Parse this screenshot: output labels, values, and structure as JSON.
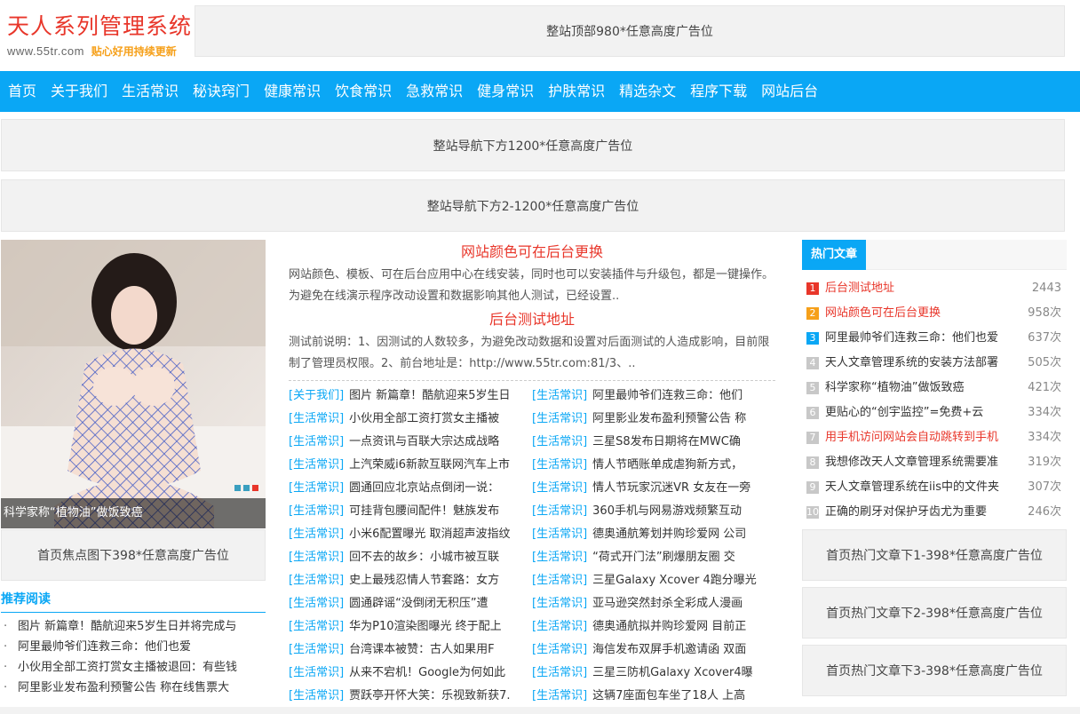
{
  "logo": {
    "title": "天人系列管理系统",
    "url": "www.55tr.com",
    "slogan": "贴心好用持续更新"
  },
  "ads": {
    "top": "整站顶部980*任意高度广告位",
    "nav1": "整站导航下方1200*任意高度广告位",
    "nav2": "整站导航下方2-1200*任意高度广告位",
    "focus_below": "首页焦点图下398*任意高度广告位",
    "hot1": "首页热门文章下1-398*任意高度广告位",
    "hot2": "首页热门文章下2-398*任意高度广告位",
    "hot3": "首页热门文章下3-398*任意高度广告位"
  },
  "nav": [
    "首页",
    "关于我们",
    "生活常识",
    "秘诀窍门",
    "健康常识",
    "饮食常识",
    "急救常识",
    "健身常识",
    "护肤常识",
    "精选杂文",
    "程序下载",
    "网站后台"
  ],
  "focus": {
    "caption": "科学家称“植物油”做饭致癌",
    "dot_colors": [
      "#3a9fbf",
      "#3a9fbf",
      "#e8362a"
    ]
  },
  "recommend": {
    "title": "推荐阅读",
    "items": [
      "图片 新篇章！酷航迎来5岁生日并将完成与",
      "阿里最帅爷们连救三命：他们也爱",
      "小伙用全部工资打赏女主播被退回：有些钱",
      "阿里影业发布盈利预警公告 称在线售票大"
    ]
  },
  "headlines": [
    {
      "title": "网站颜色可在后台更换",
      "summary": "网站颜色、模板、可在后台应用中心在线安装，同时也可以安装插件与升级包，都是一键操作。为避免在线演示程序改动设置和数据影响其他人测试，已经设置.."
    },
    {
      "title": "后台测试地址",
      "summary": "测试前说明：1、因测试的人数较多，为避免改动数据和设置对后面测试的人造成影响，目前限制了管理员权限。2、前台地址是：http://www.55tr.com:81/3、.."
    }
  ],
  "articles_left": [
    {
      "cat": "[关于我们]",
      "title": "图片 新篇章！酷航迎来5岁生日"
    },
    {
      "cat": "[生活常识]",
      "title": "小伙用全部工资打赏女主播被"
    },
    {
      "cat": "[生活常识]",
      "title": "一点资讯与百联大宗达成战略"
    },
    {
      "cat": "[生活常识]",
      "title": "上汽荣威i6新款互联网汽车上市"
    },
    {
      "cat": "[生活常识]",
      "title": "圆通回应北京站点倒闭一说："
    },
    {
      "cat": "[生活常识]",
      "title": "可挂背包腰间配件！魅族发布"
    },
    {
      "cat": "[生活常识]",
      "title": "小米6配置曝光 取消超声波指纹"
    },
    {
      "cat": "[生活常识]",
      "title": "回不去的故乡：小城市被互联"
    },
    {
      "cat": "[生活常识]",
      "title": "史上最残忍情人节套路：女方"
    },
    {
      "cat": "[生活常识]",
      "title": "圆通辟谣“没倒闭无积压”遭"
    },
    {
      "cat": "[生活常识]",
      "title": "华为P10渲染图曝光 终于配上"
    },
    {
      "cat": "[生活常识]",
      "title": "台湾课本被赞：古人如果用F"
    },
    {
      "cat": "[生活常识]",
      "title": "从来不宕机！Google为何如此"
    },
    {
      "cat": "[生活常识]",
      "title": "贾跃亭开怀大笑：乐视致新获7."
    }
  ],
  "articles_right": [
    {
      "cat": "[生活常识]",
      "title": "阿里最帅爷们连救三命：他们"
    },
    {
      "cat": "[生活常识]",
      "title": "阿里影业发布盈利预警公告 称"
    },
    {
      "cat": "[生活常识]",
      "title": "三星S8发布日期将在MWC确"
    },
    {
      "cat": "[生活常识]",
      "title": "情人节晒账单成虐狗新方式，"
    },
    {
      "cat": "[生活常识]",
      "title": "情人节玩家沉迷VR 女友在一旁"
    },
    {
      "cat": "[生活常识]",
      "title": "360手机与网易游戏频繁互动"
    },
    {
      "cat": "[生活常识]",
      "title": "德奥通航筹划并购珍爱网 公司"
    },
    {
      "cat": "[生活常识]",
      "title": "“荷式开门法”刷爆朋友圈 交"
    },
    {
      "cat": "[生活常识]",
      "title": "三星Galaxy Xcover 4跑分曝光"
    },
    {
      "cat": "[生活常识]",
      "title": "亚马逊突然封杀全彩成人漫画"
    },
    {
      "cat": "[生活常识]",
      "title": "德奥通航拟并购珍爱网 目前正"
    },
    {
      "cat": "[生活常识]",
      "title": "海信发布双屏手机邀请函 双面"
    },
    {
      "cat": "[生活常识]",
      "title": "三星三防机Galaxy Xcover4曝"
    },
    {
      "cat": "[生活常识]",
      "title": "这辆7座面包车坐了18人 上高"
    }
  ],
  "hot": {
    "title": "热门文章",
    "items": [
      {
        "rank": "1",
        "title": "后台测试地址",
        "count": "2443",
        "red": true,
        "rank_color": "#e8362a"
      },
      {
        "rank": "2",
        "title": "网站颜色可在后台更换",
        "count": "958次",
        "red": true,
        "rank_color": "#f6a01a"
      },
      {
        "rank": "3",
        "title": "阿里最帅爷们连救三命：他们也爱",
        "count": "637次",
        "red": false,
        "rank_color": "#0aa7f5"
      },
      {
        "rank": "4",
        "title": "天人文章管理系统的安装方法部署",
        "count": "505次",
        "red": false,
        "rank_color": "#c8c8c8"
      },
      {
        "rank": "5",
        "title": "科学家称“植物油”做饭致癌",
        "count": "421次",
        "red": false,
        "rank_color": "#c8c8c8"
      },
      {
        "rank": "6",
        "title": "更贴心的“创宇监控”=免费+云",
        "count": "334次",
        "red": false,
        "rank_color": "#c8c8c8"
      },
      {
        "rank": "7",
        "title": "用手机访问网站会自动跳转到手机",
        "count": "334次",
        "red": true,
        "rank_color": "#c8c8c8"
      },
      {
        "rank": "8",
        "title": "我想修改天人文章管理系统需要准",
        "count": "319次",
        "red": false,
        "rank_color": "#c8c8c8"
      },
      {
        "rank": "9",
        "title": "天人文章管理系统在iis中的文件夹",
        "count": "307次",
        "red": false,
        "rank_color": "#c8c8c8"
      },
      {
        "rank": "10",
        "title": "正确的刷牙对保护牙齿尤为重要",
        "count": "246次",
        "red": false,
        "rank_color": "#c8c8c8"
      }
    ]
  }
}
